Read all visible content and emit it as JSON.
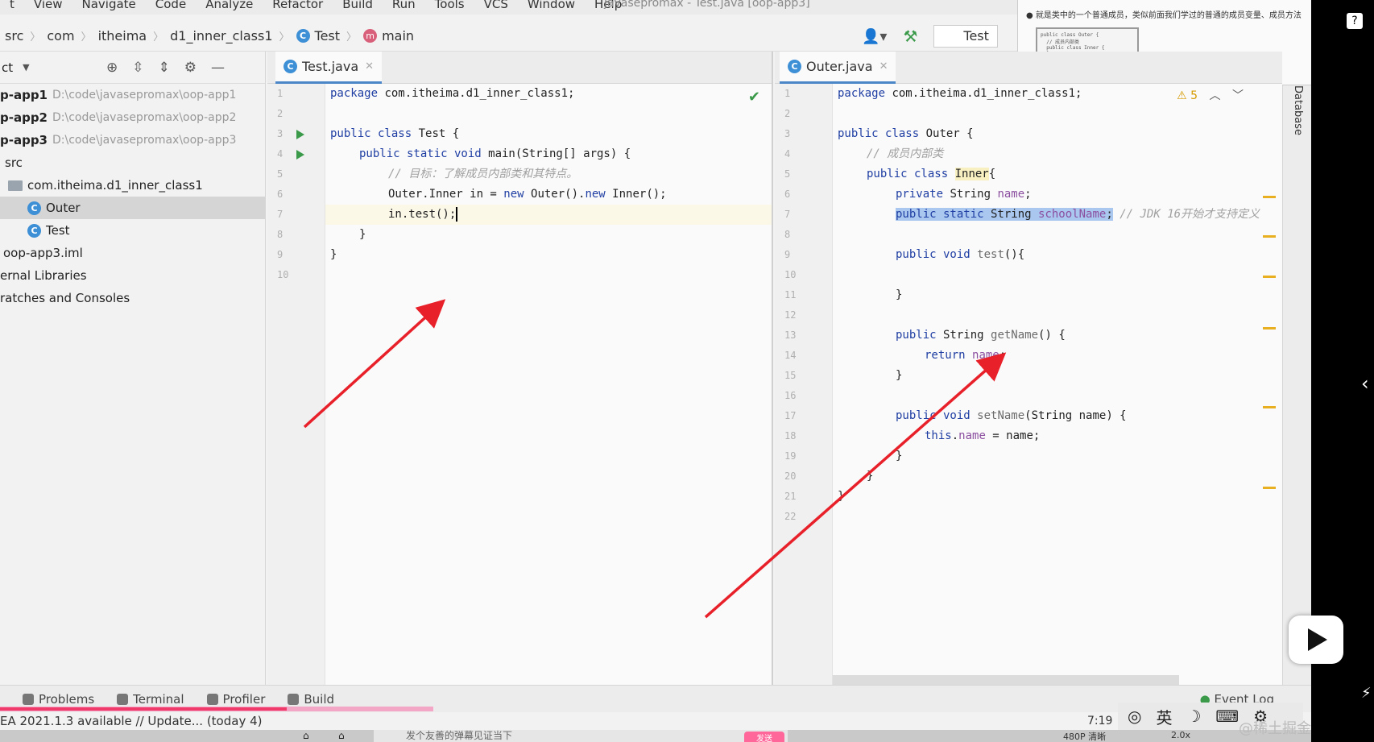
{
  "window": {
    "title": "javasepromax - Test.java [oop-app3]",
    "menus": [
      "t",
      "View",
      "Navigate",
      "Code",
      "Analyze",
      "Refactor",
      "Build",
      "Run",
      "Tools",
      "VCS",
      "Window",
      "Help"
    ]
  },
  "breadcrumb": {
    "items": [
      "src",
      "com",
      "itheima",
      "d1_inner_class1",
      "Test",
      "main"
    ]
  },
  "toolbar": {
    "run_config": "Test"
  },
  "doc_preview": {
    "text": "● 就是类中的一个普通成员，类似前面我们学过的普通的成员变量、成员方法"
  },
  "project": {
    "header": "ct",
    "items": [
      {
        "label": "p-app1",
        "path": "D:\\code\\javasepromax\\oop-app1",
        "bold": true
      },
      {
        "label": "p-app2",
        "path": "D:\\code\\javasepromax\\oop-app2",
        "bold": true
      },
      {
        "label": "p-app3",
        "path": "D:\\code\\javasepromax\\oop-app3",
        "bold": true
      },
      {
        "label": "src",
        "path": ""
      },
      {
        "label": "com.itheima.d1_inner_class1",
        "path": ""
      },
      {
        "label": "Outer",
        "path": ""
      },
      {
        "label": "Test",
        "path": ""
      },
      {
        "label": "oop-app3.iml",
        "path": ""
      },
      {
        "label": "ernal Libraries",
        "path": ""
      },
      {
        "label": "ratches and Consoles",
        "path": ""
      }
    ]
  },
  "editor_left": {
    "tab": "Test.java",
    "line_numbers": [
      "1",
      "2",
      "3",
      "4",
      "5",
      "6",
      "7",
      "8",
      "9",
      "10"
    ]
  },
  "editor_right": {
    "tab": "Outer.java",
    "warnings": "5",
    "line_numbers": [
      "1",
      "2",
      "3",
      "4",
      "5",
      "6",
      "7",
      "8",
      "9",
      "10",
      "11",
      "12",
      "13",
      "14",
      "15",
      "16",
      "17",
      "18",
      "19",
      "20",
      "21",
      "22"
    ],
    "side_tab": "Database"
  },
  "bottom_tools": {
    "problems": "Problems",
    "terminal": "Terminal",
    "profiler": "Profiler",
    "build": "Build",
    "event_log": "Event Log"
  },
  "status": {
    "message": "EA 2021.1.3 available // Update... (today 4)",
    "time": "7:19",
    "ime_lang": "英"
  },
  "player": {
    "danmu_placeholder": "发个友善的弹幕见证当下",
    "send": "发送",
    "watermark": "@稀土掘金技术社区",
    "quality": "480P 清晰",
    "speed": "2.0x"
  },
  "colors": {
    "keyword": "#1f3ea3",
    "comment": "#a0a0a0",
    "field": "#8c4fa0",
    "selection": "#a9c7ef",
    "arrow": "#e8202a"
  }
}
